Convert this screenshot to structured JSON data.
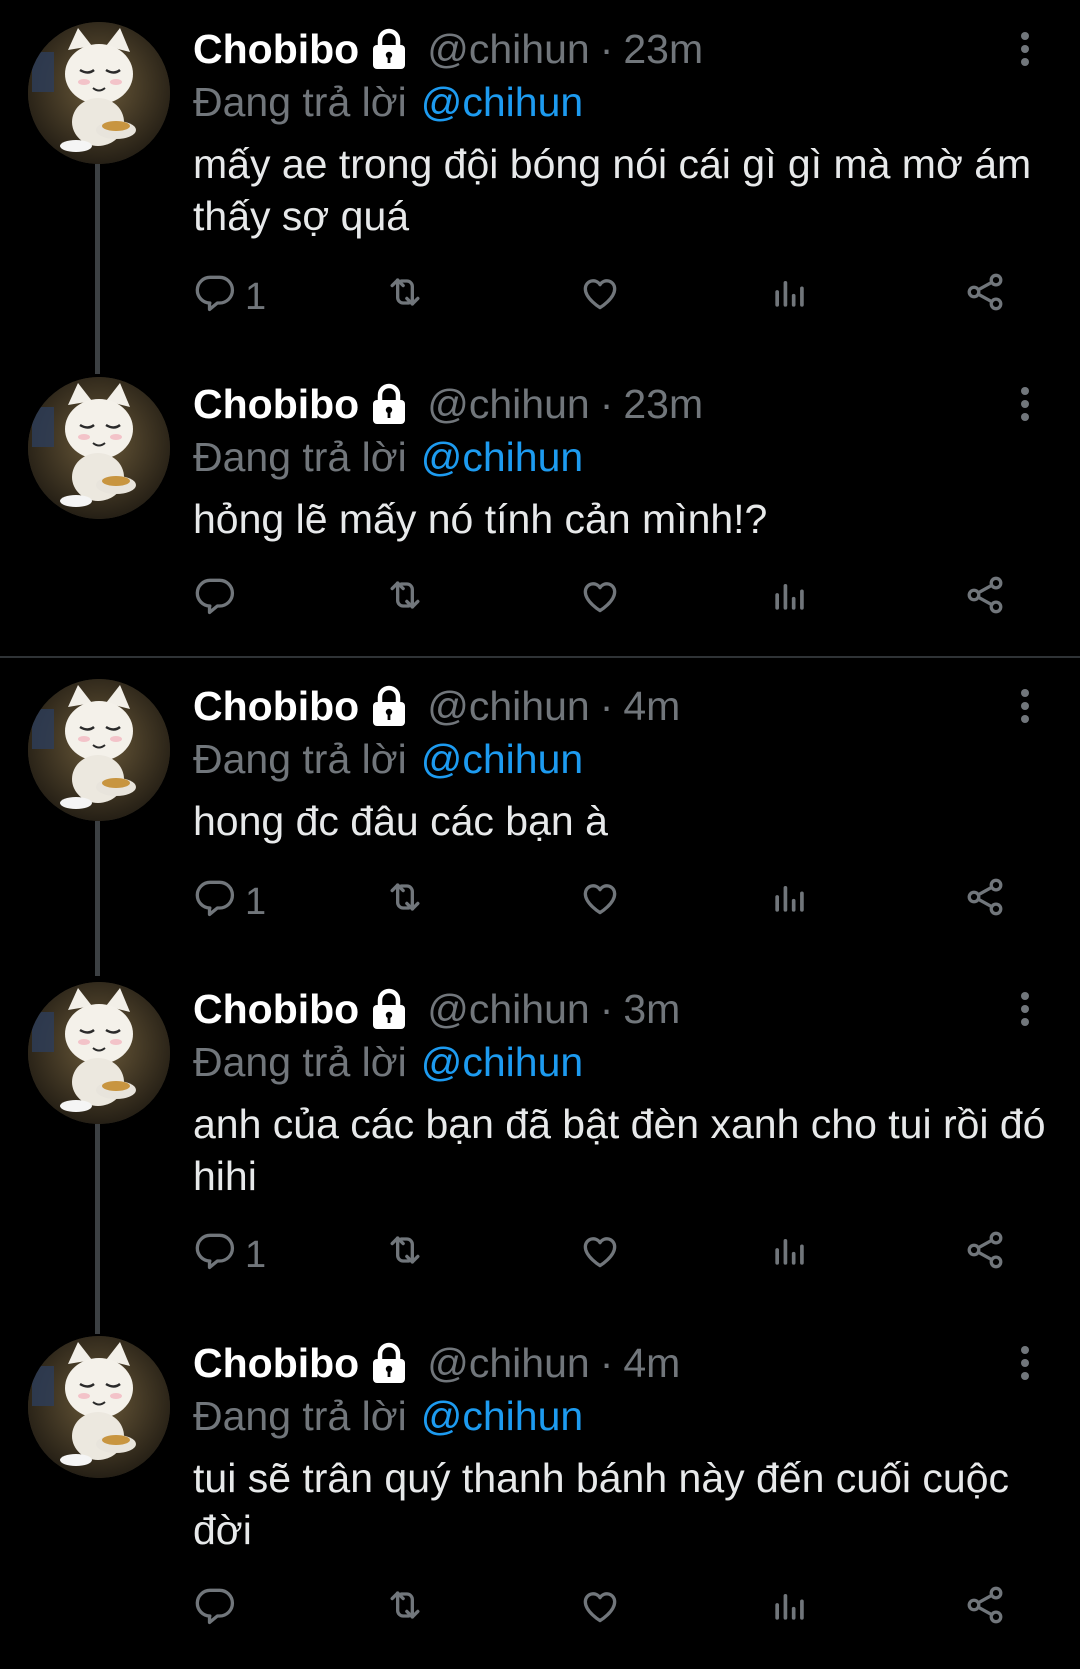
{
  "thread": {
    "reply_prefix": "Đang trả lời",
    "tweets": [
      {
        "name": "Chobibo",
        "handle": "@chihun",
        "sep": "·",
        "time": "23m",
        "reply_to": "@chihun",
        "text": "mấy ae trong đội bóng nói cái gì gì mà mờ ám thấy sợ quá",
        "reply_count": "1"
      },
      {
        "name": "Chobibo",
        "handle": "@chihun",
        "sep": "·",
        "time": "23m",
        "reply_to": "@chihun",
        "text": "hỏng lẽ mấy nó tính cản mình!?",
        "reply_count": ""
      },
      {
        "name": "Chobibo",
        "handle": "@chihun",
        "sep": "·",
        "time": "4m",
        "reply_to": "@chihun",
        "text": "hong đc đâu các bạn à",
        "reply_count": "1"
      },
      {
        "name": "Chobibo",
        "handle": "@chihun",
        "sep": "·",
        "time": "3m",
        "reply_to": "@chihun",
        "text": "anh của các bạn đã bật đèn xanh cho tui rồi đó hihi",
        "reply_count": "1"
      },
      {
        "name": "Chobibo",
        "handle": "@chihun",
        "sep": "·",
        "time": "4m",
        "reply_to": "@chihun",
        "text": "tui sẽ trân quý thanh bánh này đến cuối cuộc đời",
        "reply_count": ""
      }
    ]
  },
  "icons": {
    "lock": "lock-icon",
    "more": "more-vertical-icon",
    "reply": "reply-icon",
    "retweet": "retweet-icon",
    "like": "heart-icon",
    "views": "views-icon",
    "share": "share-icon"
  },
  "colors": {
    "background": "#000000",
    "text": "#e7e9ea",
    "muted": "#71767b",
    "link": "#1d9bf0",
    "thread_line": "#3c4043"
  }
}
